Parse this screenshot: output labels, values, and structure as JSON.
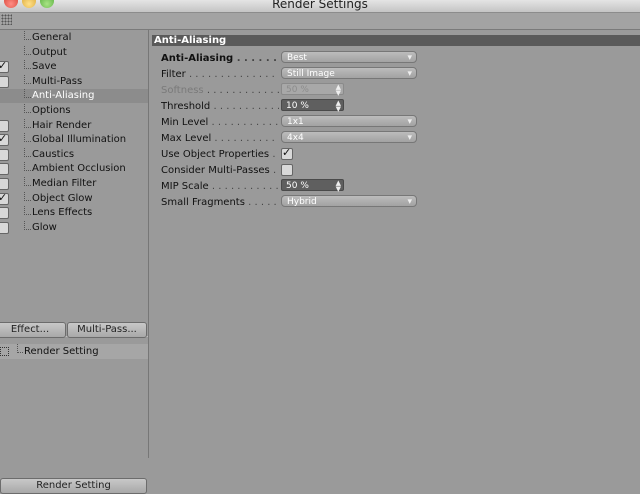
{
  "window": {
    "title": "Render Settings"
  },
  "sidebar": {
    "items": [
      {
        "label": "General",
        "has_checkbox": false,
        "checked": false,
        "selected": false
      },
      {
        "label": "Output",
        "has_checkbox": false,
        "checked": false,
        "selected": false
      },
      {
        "label": "Save",
        "has_checkbox": true,
        "checked": true,
        "selected": false
      },
      {
        "label": "Multi-Pass",
        "has_checkbox": true,
        "checked": false,
        "selected": false
      },
      {
        "label": "Anti-Aliasing",
        "has_checkbox": false,
        "checked": false,
        "selected": true
      },
      {
        "label": "Options",
        "has_checkbox": false,
        "checked": false,
        "selected": false
      },
      {
        "label": "Hair Render",
        "has_checkbox": true,
        "checked": false,
        "selected": false
      },
      {
        "label": "Global Illumination",
        "has_checkbox": true,
        "checked": true,
        "selected": false
      },
      {
        "label": "Caustics",
        "has_checkbox": true,
        "checked": false,
        "selected": false
      },
      {
        "label": "Ambient Occlusion",
        "has_checkbox": true,
        "checked": false,
        "selected": false
      },
      {
        "label": "Median Filter",
        "has_checkbox": true,
        "checked": false,
        "selected": false
      },
      {
        "label": "Object Glow",
        "has_checkbox": true,
        "checked": true,
        "selected": false
      },
      {
        "label": "Lens Effects",
        "has_checkbox": true,
        "checked": false,
        "selected": false
      },
      {
        "label": "Glow",
        "has_checkbox": true,
        "checked": false,
        "selected": false
      }
    ],
    "effect_button": "Effect...",
    "multipass_button": "Multi-Pass...",
    "render_setting_item": "Render Setting",
    "render_setting_button": "Render Setting"
  },
  "panel": {
    "header": "Anti-Aliasing",
    "rows": [
      {
        "label": "Anti-Aliasing",
        "dots": " . . . . . . . . . . .",
        "type": "dropdown",
        "value": "Best",
        "bold": true,
        "disabled": false
      },
      {
        "label": "Filter",
        "dots": " . . . . . . . . . . . . . . . . . .",
        "type": "dropdown",
        "value": "Still Image",
        "bold": false,
        "disabled": false
      },
      {
        "label": "Softness",
        "dots": " . . . . . . . . . . . . . . .",
        "type": "number",
        "value": "50 %",
        "bold": false,
        "disabled": true
      },
      {
        "label": "Threshold",
        "dots": " . . . . . . . . . . . . . .",
        "type": "number",
        "value": "10 %",
        "bold": false,
        "disabled": false
      },
      {
        "label": "Min Level",
        "dots": " . . . . . . . . . . . . . .",
        "type": "dropdown",
        "value": "1x1",
        "bold": false,
        "disabled": false
      },
      {
        "label": "Max Level",
        "dots": " . . . . . . . . . . . . . .",
        "type": "dropdown",
        "value": "4x4",
        "bold": false,
        "disabled": false
      },
      {
        "label": "Use Object Properties",
        "dots": " . . .",
        "type": "checkbox",
        "value": "",
        "checked": true,
        "bold": false,
        "disabled": false
      },
      {
        "label": "Consider Multi-Passes",
        "dots": " . .",
        "type": "checkbox",
        "value": "",
        "checked": false,
        "bold": false,
        "disabled": false
      },
      {
        "label": "MIP Scale",
        "dots": " . . . . . . . . . . . . . .",
        "type": "number",
        "value": "50 %",
        "bold": false,
        "disabled": false
      },
      {
        "label": "Small Fragments",
        "dots": " . . . . . . . . .",
        "type": "dropdown",
        "value": "Hybrid",
        "bold": false,
        "disabled": false
      }
    ]
  }
}
